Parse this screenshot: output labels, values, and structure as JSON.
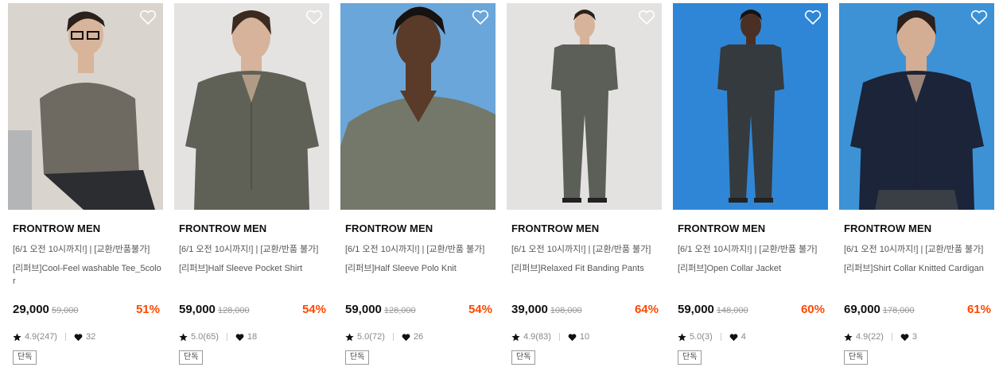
{
  "colors": {
    "discount": "#ff4800",
    "price": "#111111",
    "muted": "#888888"
  },
  "products": [
    {
      "brand": "FRONTROW MEN",
      "promo": "[6/1 오전 10시까지!] | [교환/반품불가]",
      "name": "[리퍼브]Cool-Feel washable Tee_5color",
      "price": "29,000",
      "original_price": "59,000",
      "discount": "51%",
      "rating": "4.9(247)",
      "likes": "32",
      "badge": "단독",
      "photo": {
        "bg": "#d9d4ce",
        "garment": "#6e6a62",
        "pants": "#2b2d30",
        "skin": "#d8b49a",
        "hair": "#2a211c",
        "scene": "seated"
      }
    },
    {
      "brand": "FRONTROW MEN",
      "promo": "[6/1 오전 10시까지!] | [교환/반품 불가]",
      "name": "[리퍼브]Half Sleeve Pocket Shirt",
      "price": "59,000",
      "original_price": "128,000",
      "discount": "54%",
      "rating": "5.0(65)",
      "likes": "18",
      "badge": "단독",
      "photo": {
        "bg": "#e4e3e1",
        "garment": "#5f6157",
        "pants": "#5f6157",
        "skin": "#d6b39a",
        "hair": "#3a2a20",
        "scene": "halfbody"
      }
    },
    {
      "brand": "FRONTROW MEN",
      "promo": "[6/1 오전 10시까지!] | [교환/반품 불가]",
      "name": "[리퍼브]Half Sleeve Polo Knit",
      "price": "59,000",
      "original_price": "128,000",
      "discount": "54%",
      "rating": "5.0(72)",
      "likes": "26",
      "badge": "단독",
      "photo": {
        "bg": "#6aa6d9",
        "garment": "#74786a",
        "pants": "#74786a",
        "skin": "#5a3a28",
        "hair": "#151210",
        "scene": "closeup"
      }
    },
    {
      "brand": "FRONTROW MEN",
      "promo": "[6/1 오전 10시까지!] | [교환/반품 불가]",
      "name": "[리퍼브]Relaxed Fit Banding Pants",
      "price": "39,000",
      "original_price": "108,000",
      "discount": "64%",
      "rating": "4.9(83)",
      "likes": "10",
      "badge": "단독",
      "photo": {
        "bg": "#e3e2e0",
        "garment": "#5c5f57",
        "pants": "#5c5f57",
        "skin": "#d6b39a",
        "hair": "#2a211c",
        "scene": "fullbody"
      }
    },
    {
      "brand": "FRONTROW MEN",
      "promo": "[6/1 오전 10시까지!] | [교환/반품 불가]",
      "name": "[리퍼브]Open Collar Jacket",
      "price": "59,000",
      "original_price": "148,000",
      "discount": "60%",
      "rating": "5.0(3)",
      "likes": "4",
      "badge": "단독",
      "photo": {
        "bg": "#2f86d6",
        "garment": "#353a3e",
        "pants": "#353a3e",
        "skin": "#4a3024",
        "hair": "#151210",
        "scene": "fullbody"
      }
    },
    {
      "brand": "FRONTROW MEN",
      "promo": "[6/1 오전 10시까지!] | [교환/반품 불가]",
      "name": "[리퍼브]Shirt Collar Knitted Cardigan",
      "price": "69,000",
      "original_price": "178,000",
      "discount": "61%",
      "rating": "4.9(22)",
      "likes": "3",
      "badge": "단독",
      "photo": {
        "bg": "#3d92d6",
        "garment": "#1b2438",
        "pants": "#3a3f45",
        "skin": "#d4ae94",
        "hair": "#2a211c",
        "scene": "halfbody"
      }
    }
  ]
}
